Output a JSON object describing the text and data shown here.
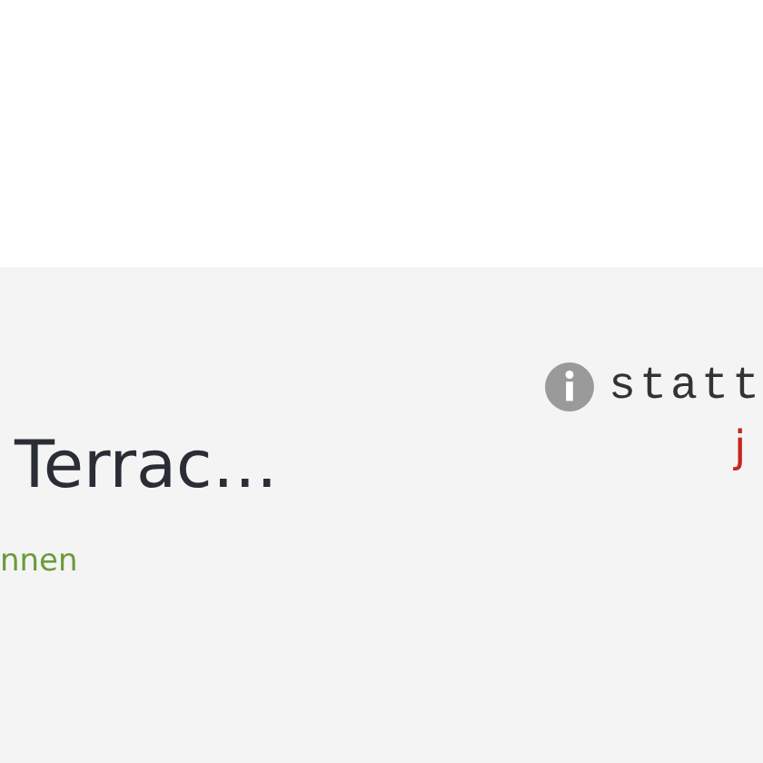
{
  "listing": {
    "title": "Terrac…",
    "subtitle": "nnen",
    "info_label": "statt",
    "price_fragment": "j"
  }
}
